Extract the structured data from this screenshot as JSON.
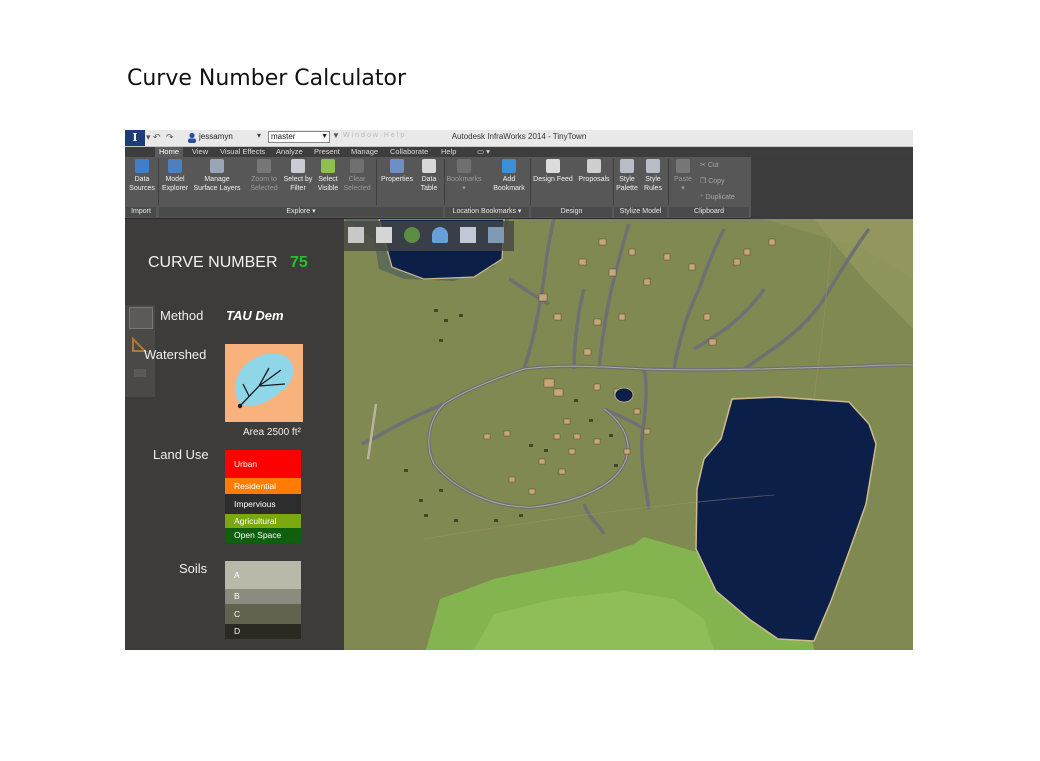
{
  "page_title": "Curve Number Calculator",
  "titlebar": {
    "app_logo": "I",
    "user": "jessamyn",
    "branch": "master",
    "faded_tools": "Window   Help",
    "window_title": "Autodesk InfraWorks 2014 - TinyTown"
  },
  "tabs": [
    "Home",
    "View",
    "Visual Effects",
    "Analyze",
    "Present",
    "Manage",
    "Collaborate",
    "Help"
  ],
  "ribbon": {
    "data_sources": [
      "Data",
      "Sources"
    ],
    "model_explorer": [
      "Model",
      "Explorer"
    ],
    "manage_surface_layers": [
      "Manage",
      "Surface Layers"
    ],
    "zoom_to_selected": [
      "Zoom to",
      "Selected"
    ],
    "select_by_filter": [
      "Select by",
      "Filter"
    ],
    "select_visible": [
      "Select",
      "Visible"
    ],
    "clear_selected": [
      "Clear",
      "Selected"
    ],
    "properties": "Properties",
    "data_table": [
      "Data",
      "Table"
    ],
    "bookmarks": "Bookmarks",
    "add_bookmark": [
      "Add",
      "Bookmark"
    ],
    "design_feed": "Design Feed",
    "proposals": "Proposals",
    "style_palette": [
      "Style",
      "Palette"
    ],
    "style_rules": [
      "Style",
      "Rules"
    ],
    "paste": "Paste",
    "cut": "Cut",
    "copy": "Copy",
    "duplicate": "Duplicate",
    "groups": {
      "import": "Import",
      "explore": "Explore ▾",
      "location_bookmarks": "Location Bookmarks ▾",
      "design": "Design",
      "stylize_model": "Stylize Model",
      "clipboard": "Clipboard"
    }
  },
  "panel": {
    "curve_number_label": "CURVE NUMBER",
    "curve_number_value": "75",
    "method_label": "Method",
    "method_value": "TAU Dem",
    "watershed_label": "Watershed",
    "area_label": "Area 2500 ft²",
    "land_use_label": "Land Use",
    "land_use": [
      {
        "label": "Urban",
        "color": "#ff0000"
      },
      {
        "label": "Residential",
        "color": "#ff7c00"
      },
      {
        "label": "Impervious",
        "color": "#2d2d2d"
      },
      {
        "label": "Agricultural",
        "color": "#7aa80f"
      },
      {
        "label": "Open Space",
        "color": "#0f5f0f"
      }
    ],
    "soils_label": "Soils",
    "soils": [
      {
        "label": "A",
        "color": "#b9b9aa"
      },
      {
        "label": "B",
        "color": "#8b8b7f"
      },
      {
        "label": "C",
        "color": "#62624f"
      },
      {
        "label": "D",
        "color": "#2a2a22"
      }
    ]
  },
  "colors": {
    "curve_number_value": "#22c22a",
    "map_ground": "#7d8752",
    "water": "#0b1f48",
    "road": "#6f7073"
  }
}
